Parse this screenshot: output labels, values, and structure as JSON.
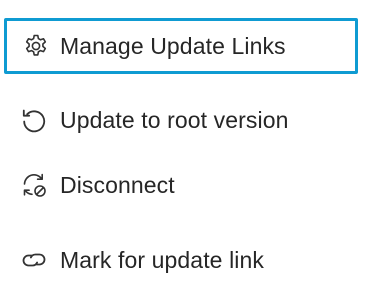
{
  "menu": {
    "items": [
      {
        "label": "Manage Update Links",
        "icon": "gear-icon",
        "focused": true
      },
      {
        "label": "Update to root version",
        "icon": "rotate-left-icon",
        "focused": false
      },
      {
        "label": "Disconnect",
        "icon": "disconnect-sync-icon",
        "focused": false
      },
      {
        "label": "Mark for update link",
        "icon": "link-icon",
        "focused": false
      }
    ]
  },
  "colors": {
    "focus_border": "#0f9bd2",
    "text": "#262626",
    "icon": "#333333"
  }
}
